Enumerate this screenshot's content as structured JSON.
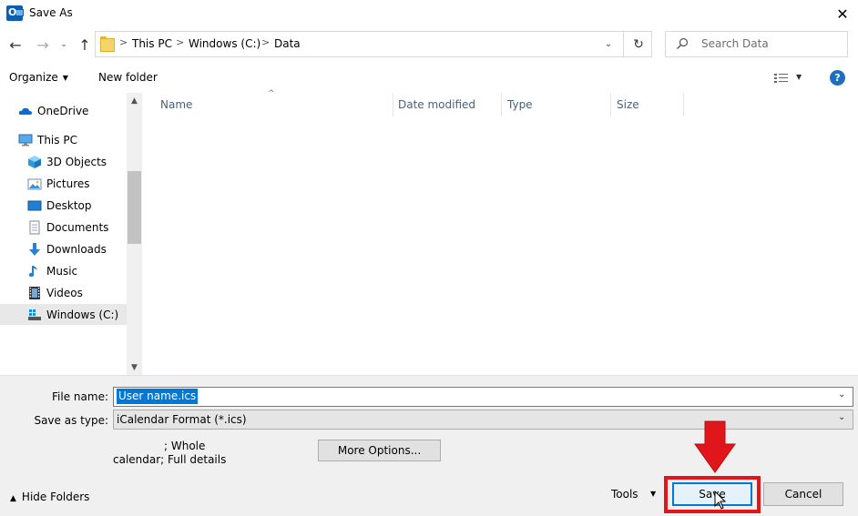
{
  "window": {
    "title": "Save As",
    "close_glyph": "✕"
  },
  "nav": {
    "back_glyph": "←",
    "forward_glyph": "→",
    "recent_glyph": "⌄",
    "up_glyph": "↑",
    "refresh_glyph": "↻",
    "dropdown_glyph": "⌄",
    "breadcrumbs": [
      "This PC",
      "Windows (C:)",
      "Data"
    ],
    "crumb_separator": ">"
  },
  "search": {
    "placeholder": "Search Data"
  },
  "toolbar": {
    "organize_label": "Organize",
    "new_folder_label": "New folder",
    "help_glyph": "?",
    "chevron_glyph": "▼"
  },
  "tree": {
    "items": [
      {
        "label": "OneDrive",
        "icon": "cloud-icon"
      },
      {
        "label": "This PC",
        "icon": "computer-icon"
      },
      {
        "label": "3D Objects",
        "icon": "cube-icon"
      },
      {
        "label": "Pictures",
        "icon": "pictures-icon"
      },
      {
        "label": "Desktop",
        "icon": "desktop-icon"
      },
      {
        "label": "Documents",
        "icon": "documents-icon"
      },
      {
        "label": "Downloads",
        "icon": "download-icon"
      },
      {
        "label": "Music",
        "icon": "music-icon"
      },
      {
        "label": "Videos",
        "icon": "videos-icon"
      },
      {
        "label": "Windows (C:)",
        "icon": "drive-icon"
      }
    ],
    "scroll_up_glyph": "▲",
    "scroll_down_glyph": "▼"
  },
  "columns": [
    "Name",
    "Date modified",
    "Type",
    "Size"
  ],
  "sort_glyph": "^",
  "form": {
    "filename_label": "File name:",
    "filename_value": "User name.ics",
    "filetype_label": "Save as type:",
    "filetype_value": "iCalendar Format (*.ics)",
    "details_line1": "; Whole",
    "details_line2": "calendar; Full details",
    "more_options_label": "More Options...",
    "dropdown_glyph": "⌄"
  },
  "footer": {
    "hide_folders_label": "Hide Folders",
    "hide_folders_glyph": "▲",
    "tools_label": "Tools",
    "tools_glyph": "▼",
    "save_label": "Save",
    "cancel_label": "Cancel"
  },
  "colors": {
    "accent": "#0078d7",
    "highlight": "#e0161b"
  }
}
